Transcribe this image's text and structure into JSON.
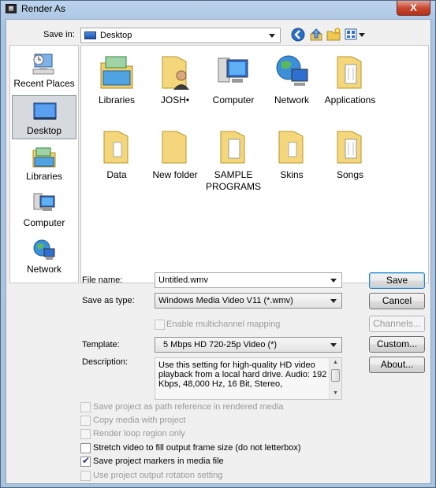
{
  "window": {
    "title": "Render As",
    "close_glyph": "X"
  },
  "save_in": {
    "label": "Save in:",
    "value": "Desktop",
    "icons": [
      "back-icon",
      "up-folder-icon",
      "new-folder-icon",
      "view-menu-icon"
    ]
  },
  "places": [
    {
      "label": "Recent Places",
      "icon": "recent-places-icon",
      "selected": false
    },
    {
      "label": "Desktop",
      "icon": "desktop-icon",
      "selected": true
    },
    {
      "label": "Libraries",
      "icon": "libraries-icon",
      "selected": false
    },
    {
      "label": "Computer",
      "icon": "computer-icon",
      "selected": false
    },
    {
      "label": "Network",
      "icon": "network-icon",
      "selected": false
    }
  ],
  "files": [
    {
      "label": "Libraries",
      "icon": "libraries-icon"
    },
    {
      "label": "JOSH•",
      "icon": "user-folder-icon"
    },
    {
      "label": "Computer",
      "icon": "computer-icon"
    },
    {
      "label": "Network",
      "icon": "network-icon"
    },
    {
      "label": "Applications",
      "icon": "folder-icon"
    },
    {
      "label": "Data",
      "icon": "folder-icon"
    },
    {
      "label": "New folder",
      "icon": "folder-icon"
    },
    {
      "label": "SAMPLE PROGRAMS",
      "icon": "folder-icon"
    },
    {
      "label": "Skins",
      "icon": "folder-icon"
    },
    {
      "label": "Songs",
      "icon": "folder-icon"
    }
  ],
  "form": {
    "file_name_label": "File name:",
    "file_name_value": "Untitled.wmv",
    "save_as_type_label": "Save as type:",
    "save_as_type_value": "Windows Media Video V11 (*.wmv)",
    "multichannel_label": "Enable multichannel mapping",
    "template_label": "Template:",
    "template_value": "5 Mbps HD 720-25p Video (*)",
    "description_label": "Description:",
    "description_text": "Use this setting for high-quality HD video playback from a local hard drive. Audio: 192 Kbps, 48,000 Hz, 16 Bit, Stereo,"
  },
  "buttons": {
    "save": "Save",
    "cancel": "Cancel",
    "channels": "Channels...",
    "custom": "Custom...",
    "about": "About..."
  },
  "options": [
    {
      "label": "Save project as path reference in rendered media",
      "checked": false,
      "enabled": false
    },
    {
      "label": "Copy media with project",
      "checked": false,
      "enabled": false
    },
    {
      "label": "Render loop region only",
      "checked": false,
      "enabled": false
    },
    {
      "label": "Stretch video to fill output frame size (do not letterbox)",
      "checked": false,
      "enabled": true
    },
    {
      "label": "Save project markers in media file",
      "checked": true,
      "enabled": true
    },
    {
      "label": "Use project output rotation setting",
      "checked": false,
      "enabled": false
    }
  ]
}
